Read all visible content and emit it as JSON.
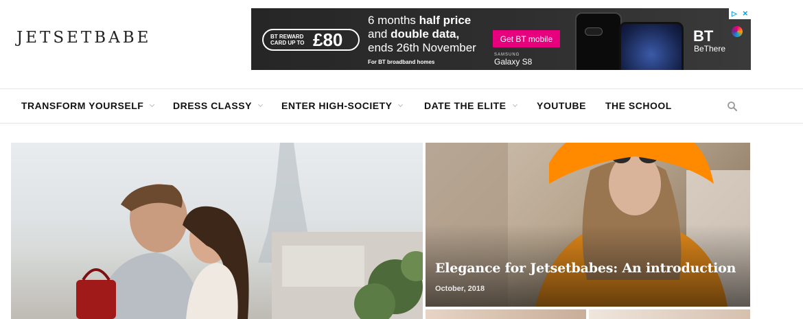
{
  "site": {
    "logo": "JETSETBABE"
  },
  "ad": {
    "reward_small": "BT REWARD CARD UP TO",
    "reward_amount": "£80",
    "line1_pre": "6 months ",
    "line1_bold": "half price",
    "line2_pre": "and ",
    "line2_bold": "double data,",
    "line3": "ends 26th November",
    "fine_print": "For BT broadband homes",
    "cta": "Get BT mobile",
    "device_brand": "SAMSUNG",
    "device_name": "Galaxy S8",
    "brand": "BT",
    "tagline": "BeThere",
    "choices_icon": "adchoices-icon"
  },
  "nav": {
    "items": [
      {
        "label": "TRANSFORM YOURSELF",
        "has_dropdown": true
      },
      {
        "label": "DRESS CLASSY",
        "has_dropdown": true
      },
      {
        "label": "ENTER HIGH-SOCIETY",
        "has_dropdown": true
      },
      {
        "label": "DATE THE ELITE",
        "has_dropdown": true
      },
      {
        "label": "YOUTUBE",
        "has_dropdown": false
      },
      {
        "label": "THE SCHOOL",
        "has_dropdown": false
      }
    ],
    "search_icon": "search-icon"
  },
  "featured": {
    "side_post": {
      "title": "Elegance for Jetsetbabes: An introduction",
      "date": "October, 2018"
    }
  }
}
